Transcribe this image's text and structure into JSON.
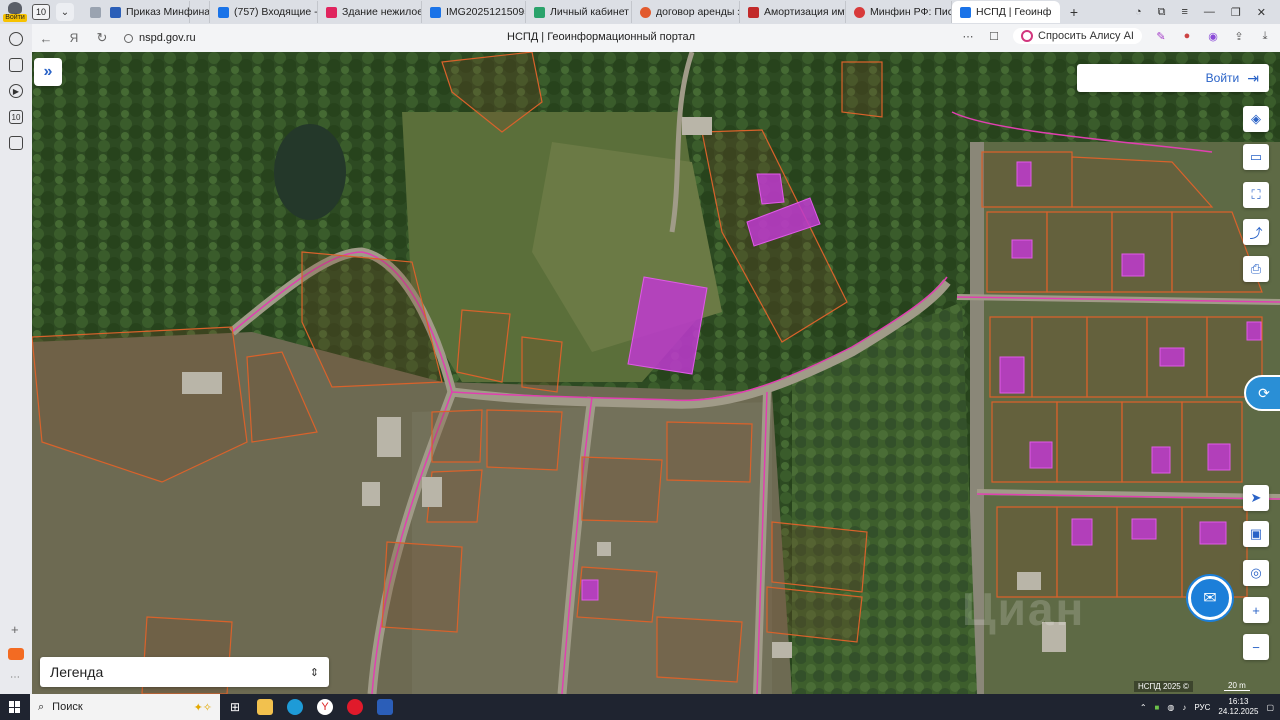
{
  "browser": {
    "tab_count": "10",
    "profile_label": "Войти",
    "tabs": [
      {
        "title": "Приказ Минфина Р",
        "favicon": "#2b5fb8"
      },
      {
        "title": "(757) Входящие - Г",
        "favicon": "#1a73e8"
      },
      {
        "title": "Здание нежилое (",
        "favicon": "#e0245e"
      },
      {
        "title": "IMG202512150959",
        "favicon": "#1a73e8"
      },
      {
        "title": "Личный кабинет",
        "favicon": "#2aa36b"
      },
      {
        "title": "договор аренды за",
        "favicon": "#e25a2d"
      },
      {
        "title": "Амортизация иму",
        "favicon": "#c22a2a"
      },
      {
        "title": "Минфин РФ: Письм",
        "favicon": "#d83a3a"
      },
      {
        "title": "НСПД | Геоинф",
        "favicon": "#1a73e8",
        "active": true
      }
    ],
    "url": "nspd.gov.ru",
    "page_title": "НСПД | Геоинформационный портал",
    "alisa_label": "Спросить Алису AI"
  },
  "map": {
    "login_label": "Войти",
    "legend_label": "Легенда",
    "attribution": "НСПД 2025 ©",
    "scale_label": "20 m",
    "watermark": "Циан"
  },
  "taskbar": {
    "search_label": "Поиск",
    "lang": "РУС",
    "time": "16:13",
    "date": "24.12.2025"
  }
}
